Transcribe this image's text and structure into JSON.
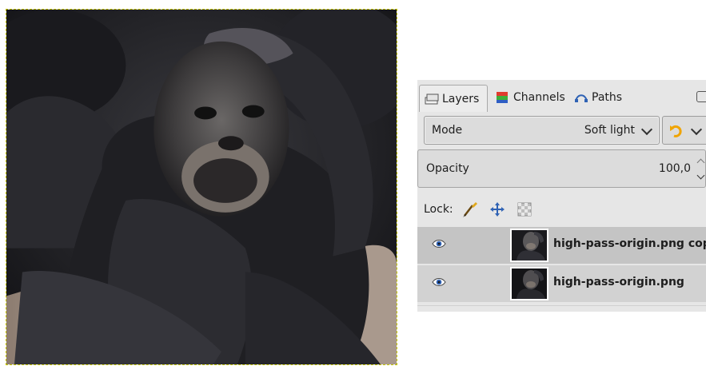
{
  "tabs": [
    {
      "label": "Layers",
      "icon": "layers-icon",
      "active": true
    },
    {
      "label": "Channels",
      "icon": "channels-icon",
      "active": false
    },
    {
      "label": "Paths",
      "icon": "paths-icon",
      "active": false
    }
  ],
  "mode": {
    "label": "Mode",
    "value": "Soft light"
  },
  "opacity": {
    "label": "Opacity",
    "value": "100,0"
  },
  "lock": {
    "label": "Lock:",
    "icons": [
      "lock-pixels-icon",
      "lock-position-icon",
      "lock-alpha-icon"
    ]
  },
  "layers": [
    {
      "name": "high-pass-origin.png copy",
      "visible": true,
      "selected": true
    },
    {
      "name": "high-pass-origin.png",
      "visible": true,
      "selected": false
    }
  ],
  "colors": {
    "accent_eye": "#2f62b4",
    "selection": "#c4c4c4",
    "dock_bg": "#e6e6e6",
    "canvas_border": "#c8c800"
  }
}
